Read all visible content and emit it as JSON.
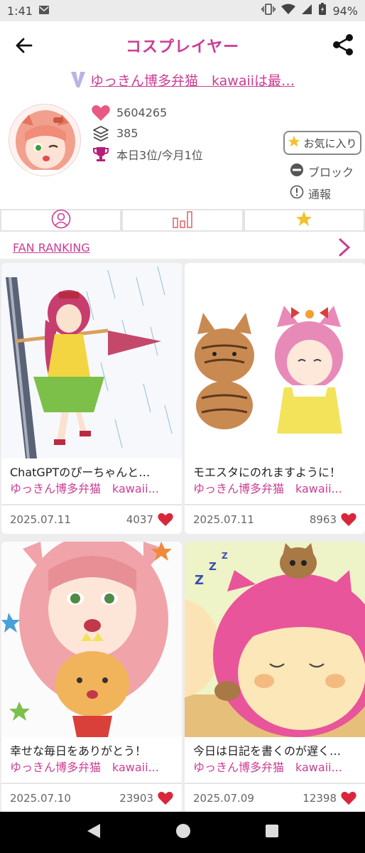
{
  "status_bar": {
    "time": "1:41",
    "battery": "94%"
  },
  "header": {
    "title": "コスプレイヤー"
  },
  "profile": {
    "name": "ゆっきん博多弁猫　kawaiiは最…",
    "likes": "5604265",
    "posts": "385",
    "rank": "本日3位/今月1位",
    "favorite_label": "お気に入り",
    "block_label": "ブロック",
    "report_label": "通報"
  },
  "ranking": {
    "label": "FAN RANKING"
  },
  "posts": [
    {
      "title": "ChatGPTのぴーちゃんと…",
      "author": "ゆっきん博多弁猫　kawaii...",
      "date": "2025.07.11",
      "count": "4037"
    },
    {
      "title": "モエスタにのれますように！",
      "author": "ゆっきん博多弁猫　kawaii...",
      "date": "2025.07.11",
      "count": "8963"
    },
    {
      "title": "幸せな毎日をありがとう！",
      "author": "ゆっきん博多弁猫　kawaii...",
      "date": "2025.07.10",
      "count": "23903"
    },
    {
      "title": "今日は日記を書くのが遅く…",
      "author": "ゆっきん博多弁猫　kawaii...",
      "date": "2025.07.09",
      "count": "12398"
    }
  ],
  "colors": {
    "accent": "#cc3d93",
    "heart": "#d9263a",
    "star": "#f2c12e"
  }
}
